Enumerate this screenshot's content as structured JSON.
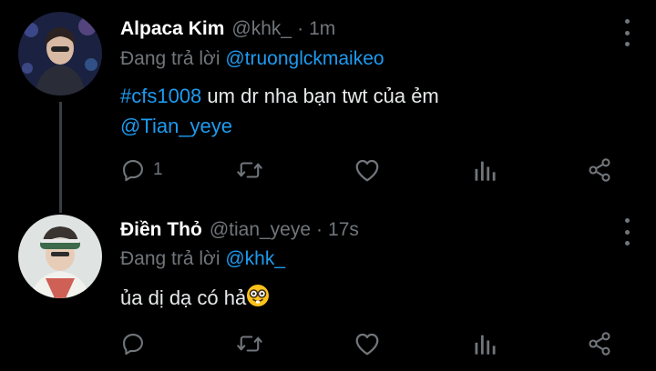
{
  "tweets": [
    {
      "name": "Alpaca Kim",
      "handle": "@khk_",
      "separator": "·",
      "time": "1m",
      "reply_prefix": "Đang trả lời",
      "reply_to": "@truonglckmaikeo",
      "hashtag": "#cfs1008",
      "text": " um dr nha bạn twt của ẻm",
      "mention": "@Tian_yeye",
      "reply_count": "1",
      "icons": [
        "reply-icon",
        "retweet-icon",
        "like-icon",
        "stats-icon",
        "share-icon",
        "more-icon"
      ]
    },
    {
      "name": "Điền Thỏ",
      "handle": "@tian_yeye",
      "separator": "·",
      "time": "17s",
      "reply_prefix": "Đang trả lời",
      "reply_to": "@khk_",
      "text": "ủa dị dạ có hả",
      "emoji": "nerd-face-emoji",
      "icons": [
        "reply-icon",
        "retweet-icon",
        "like-icon",
        "stats-icon",
        "share-icon",
        "more-icon"
      ]
    }
  ],
  "colors": {
    "background": "#000000",
    "primary_text": "#e7e9ea",
    "secondary_text": "#71767b",
    "link": "#1d9bf0",
    "thread_line": "#3a3d41"
  }
}
